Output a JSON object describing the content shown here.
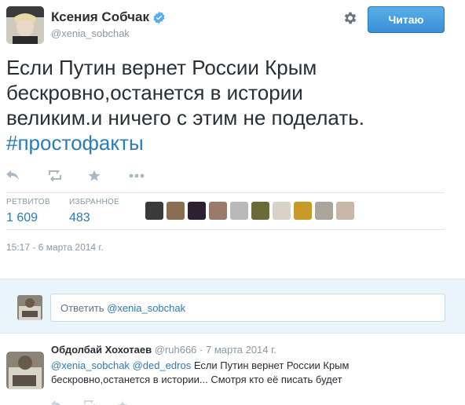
{
  "header": {
    "fullname": "Ксения Собчак",
    "handle": "@xenia_sobchak",
    "follow_label": "Читаю"
  },
  "tweet": {
    "text_line1": "Если Путин вернет России Крым",
    "text_line2": "бескровно,останется в истории",
    "text_line3": "великим.и ничего с этим не поделать.",
    "hashtag": "#простофакты"
  },
  "stats": {
    "retweets_label": "РЕТВИТОВ",
    "retweets_value": "1 609",
    "favorites_label": "ИЗБРАННОЕ",
    "favorites_value": "483"
  },
  "favoriter_colors": [
    "#3a3a3a",
    "#8a6e52",
    "#2d2030",
    "#9a7a6a",
    "#b9b9b9",
    "#6a6a3a",
    "#d9d2c8",
    "#c89a2a",
    "#a9a59a",
    "#c9b8a8"
  ],
  "timestamp": "15:17 - 6 марта 2014 г.",
  "reply_box": {
    "prefix": "Ответить ",
    "mention": "@xenia_sobchak"
  },
  "reply_tweet": {
    "name": "Обдолбай Хохотаев",
    "handle": "@ruh666",
    "date": "· 7 марта 2014 г.",
    "mention1": "@xenia_sobchak",
    "mention2": "@ded_edros",
    "text_line1": " Если Путин вернет России Крым",
    "text_line2": "бескровно,останется в истории... Смотря кто её писать будет"
  },
  "colors": {
    "accent": "#2b7bb9",
    "muted": "#8899a6",
    "reply_bg": "#eaf4fb"
  },
  "icons": [
    "verified-icon",
    "gear-icon",
    "reply-icon",
    "retweet-icon",
    "favorite-icon",
    "more-icon"
  ]
}
